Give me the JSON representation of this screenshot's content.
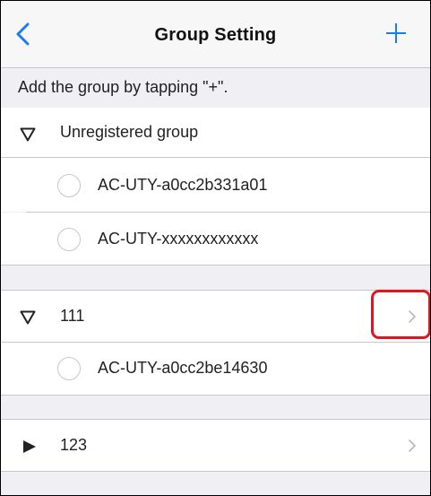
{
  "nav": {
    "title": "Group Setting",
    "back_icon": "chevron-left-icon",
    "add_icon": "plus-icon",
    "accent_color": "#1a7cf5"
  },
  "hint": "Add the group by tapping \"+\".",
  "groups": [
    {
      "name": "Unregistered group",
      "expanded": true,
      "has_chevron": false,
      "devices": [
        "AC-UTY-a0cc2b331a01",
        "AC-UTY-xxxxxxxxxxxx"
      ]
    },
    {
      "name": "111",
      "expanded": true,
      "has_chevron": true,
      "highlighted_chevron": true,
      "devices": [
        "AC-UTY-a0cc2be14630"
      ]
    },
    {
      "name": "123",
      "expanded": false,
      "has_chevron": true,
      "devices": []
    }
  ],
  "colors": {
    "highlight": "#e5141c",
    "section_gap": "#efeff4"
  }
}
